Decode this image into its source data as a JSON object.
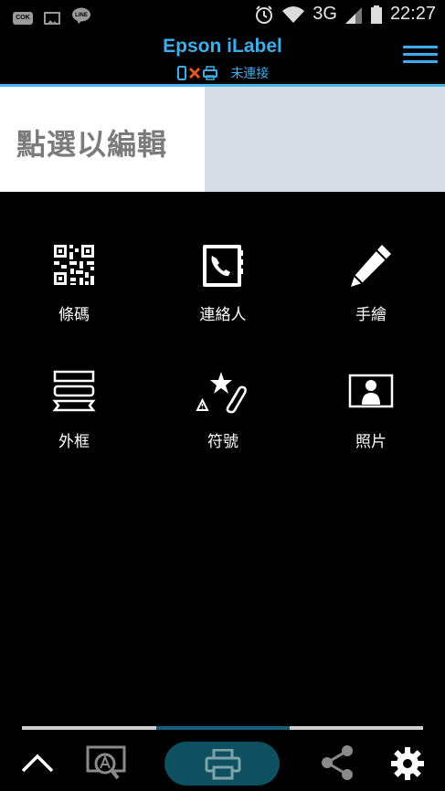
{
  "status_bar": {
    "left_icons": [
      "cok-notification-icon",
      "image-notification-icon",
      "line-notification-icon"
    ],
    "cok_text": "COK",
    "network": "3G",
    "time": "22:27"
  },
  "header": {
    "title": "Epson iLabel",
    "connection_status": "未連接",
    "accent_color": "#3daeea"
  },
  "edit_area": {
    "prompt": "點選以編輯"
  },
  "tools": [
    {
      "label": "條碼",
      "icon": "qr-code-icon"
    },
    {
      "label": "連絡人",
      "icon": "contact-book-icon"
    },
    {
      "label": "手繪",
      "icon": "pencil-icon"
    },
    {
      "label": "外框",
      "icon": "frame-icon"
    },
    {
      "label": "符號",
      "icon": "symbol-icon"
    },
    {
      "label": "照片",
      "icon": "photo-icon"
    }
  ],
  "bottom_bar": {
    "icons": [
      "chevron-up-icon",
      "text-recognition-icon",
      "print-icon",
      "share-icon",
      "settings-gear-icon"
    ]
  },
  "page_indicator": {
    "active_page": 2,
    "page_count": 3
  }
}
